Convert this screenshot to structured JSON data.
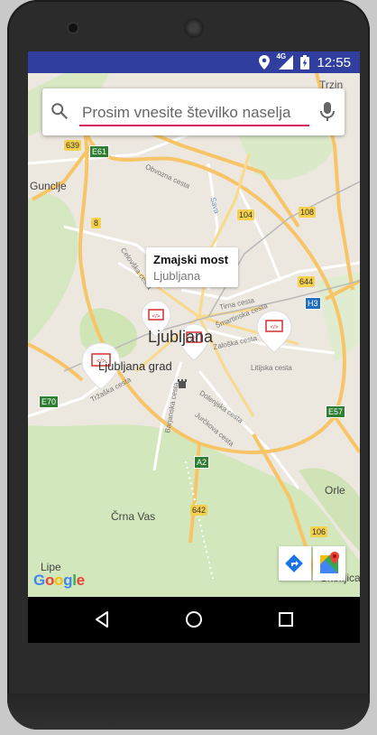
{
  "status": {
    "network": "4G",
    "time": "12:55"
  },
  "search": {
    "placeholder": "Prosim vnesite številko naselja"
  },
  "info_window": {
    "title": "Zmajski most",
    "subtitle": "Ljubljana"
  },
  "map": {
    "city_label": "Ljubljana",
    "labels": {
      "guncljel": "Guncljе",
      "trzin": "Trzin",
      "ljubljana_grad": "Ljubljana grad",
      "crna_vas": "Črna Vas",
      "lipe": "Lipe",
      "orle": "Orle",
      "skofljica": "Škofljica"
    },
    "streets": {
      "obvozna": "Obvozna cesta",
      "sava": "Sava",
      "celovska": "Celovška cesta",
      "smartinska": "Šmartinska cesta",
      "zaloska": "Zaloška cesta",
      "litijska": "Litijska cesta",
      "trzaska": "Tržaška cesta",
      "barjanska": "Barjanska cesta",
      "dolenjska": "Dolenjska cesta",
      "jurckova": "Jurčkova cesta",
      "tirna": "Tirna cesta",
      "cesta": "cesta"
    },
    "road_badges": {
      "r639": "639",
      "e61": "E61",
      "r8": "8",
      "r104": "104",
      "r108": "108",
      "r644": "644",
      "h3": "H3",
      "e70": "E70",
      "e57": "E57",
      "a2": "A2",
      "r642": "642",
      "r106": "106"
    },
    "logo": "Google"
  },
  "colors": {
    "status_bar": "#303f9f",
    "accent": "#d81b60",
    "map_land": "#ece7df",
    "park": "#cfe5b6",
    "road_major": "#f7c567",
    "nav_bar": "#000000"
  }
}
